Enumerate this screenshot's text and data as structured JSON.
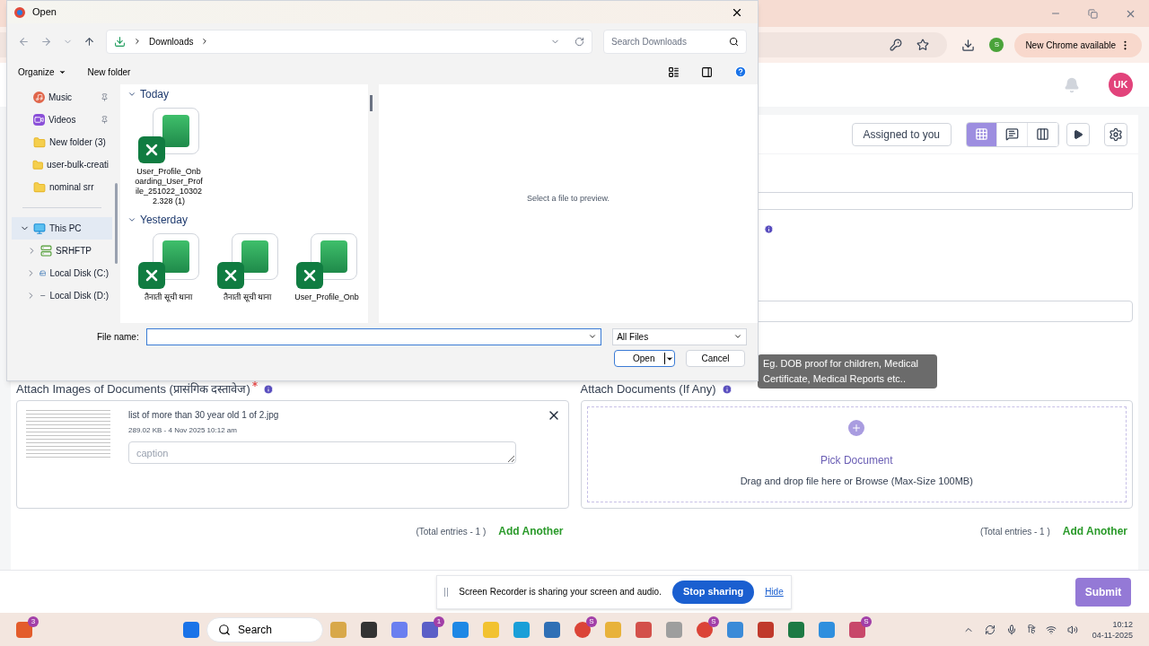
{
  "browser": {
    "new_chrome": "New Chrome available",
    "profile_initial": "S"
  },
  "app_header": {
    "avatar": "UK"
  },
  "toolbar": {
    "assigned_button": "Assigned to you",
    "views": [
      {
        "kind": "grid",
        "selected": true
      },
      {
        "kind": "comments",
        "selected": false
      },
      {
        "kind": "columns",
        "selected": false
      }
    ]
  },
  "attach_images": {
    "title": "Attach Images of Documents (प्रासंगिक दस्तावेज)",
    "required": true,
    "file": {
      "name": "list of more than 30 year old 1 of 2.jpg",
      "meta": "289.02 KB - 4 Nov 2025 10:12 am",
      "caption_placeholder": "caption"
    },
    "total": "(Total entries - 1 )",
    "add": "Add Another"
  },
  "attach_documents": {
    "title": "Attach Documents (If Any)",
    "tooltip": "Eg. DOB proof for children, Medical Certificate, Medical Reports etc..",
    "pick": "Pick Document",
    "hint": "Drag and drop file here or Browse (Max-Size 100MB)",
    "total": "(Total entries - 1 )",
    "add": "Add Another"
  },
  "share_bar": {
    "message": "Screen Recorder is sharing your screen and audio.",
    "stop": "Stop sharing",
    "hide": "Hide"
  },
  "submit": "Submit",
  "dialog": {
    "title": "Open",
    "breadcrumb": "Downloads",
    "search_placeholder": "Search Downloads",
    "organize": "Organize",
    "new_folder": "New folder",
    "nav": [
      {
        "label": "Music",
        "kind": "music",
        "pinned": true,
        "selected": false
      },
      {
        "label": "Videos",
        "kind": "video",
        "pinned": true,
        "selected": false
      },
      {
        "label": "New folder (3)",
        "kind": "folder",
        "pinned": false,
        "selected": false
      },
      {
        "label": "user-bulk-creati",
        "kind": "folder",
        "pinned": false,
        "selected": false
      },
      {
        "label": "nominal srr",
        "kind": "folder",
        "pinned": false,
        "selected": false
      },
      {
        "label": "This PC",
        "kind": "pc",
        "selected": true,
        "expanded": true,
        "children": [
          {
            "label": "SRHFTP",
            "kind": "network",
            "selected": false,
            "expanded": false
          },
          {
            "label": "Local Disk (C:)",
            "kind": "disk",
            "selected": false,
            "expanded": false
          },
          {
            "label": "Local Disk (D:)",
            "kind": "drive",
            "selected": false,
            "expanded": false
          }
        ]
      }
    ],
    "groups": [
      {
        "label": "Today",
        "expanded": true,
        "files": [
          {
            "name": "User_Profile_Onboarding_User_Profile_251022_103022.328 (1)"
          }
        ]
      },
      {
        "label": "Yesterday",
        "expanded": true,
        "files": [
          {
            "name": "तैनाती सूची थाना"
          },
          {
            "name": "तैनाती सूची थाना"
          },
          {
            "name": "User_Profile_Onb"
          }
        ]
      }
    ],
    "preview_text": "Select a file to preview.",
    "file_name_label": "File name:",
    "file_type": "All Files",
    "open": "Open",
    "cancel": "Cancel"
  },
  "taskbar": {
    "search": "Search",
    "time": "10:12",
    "date": "04-11-2025",
    "language": "हि",
    "apps": [
      {
        "kind": "widget",
        "badge": "3"
      },
      {
        "kind": "start"
      },
      {
        "kind": "search"
      },
      {
        "kind": "pharaoh"
      },
      {
        "kind": "taskview"
      },
      {
        "kind": "copilot"
      },
      {
        "kind": "teams",
        "badge": "1"
      },
      {
        "kind": "blue"
      },
      {
        "kind": "explorer"
      },
      {
        "kind": "edge"
      },
      {
        "kind": "store"
      },
      {
        "kind": "chrome",
        "badge": "S"
      },
      {
        "kind": "tools"
      },
      {
        "kind": "office"
      },
      {
        "kind": "window"
      },
      {
        "kind": "chrome",
        "badge": "S"
      },
      {
        "kind": "notepad"
      },
      {
        "kind": "globe"
      },
      {
        "kind": "excel"
      },
      {
        "kind": "photos"
      },
      {
        "kind": "recorder",
        "badge": "S"
      }
    ]
  }
}
